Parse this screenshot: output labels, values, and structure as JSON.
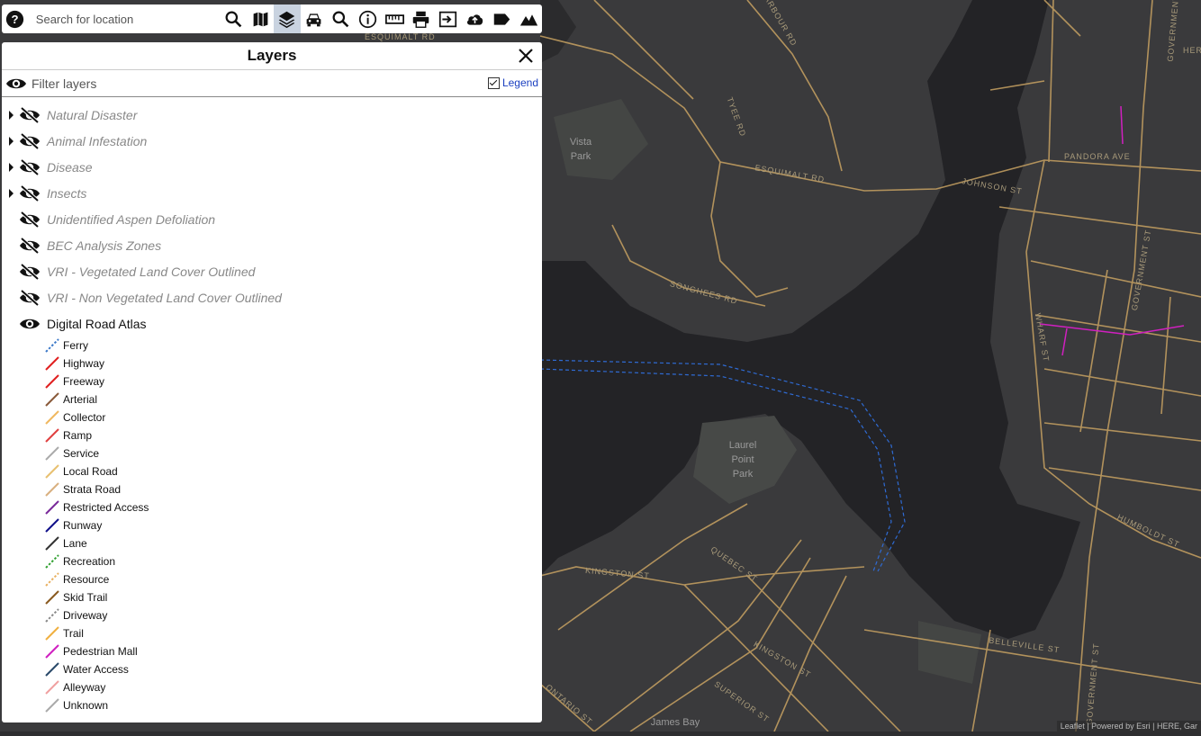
{
  "toolbar": {
    "search_placeholder": "Search for location",
    "buttons": [
      {
        "name": "help-icon"
      },
      {
        "name": "search-icon"
      },
      {
        "name": "map-icon"
      },
      {
        "name": "layers-icon",
        "active": true
      },
      {
        "name": "car-icon"
      },
      {
        "name": "identify-search-icon"
      },
      {
        "name": "info-icon"
      },
      {
        "name": "ruler-icon"
      },
      {
        "name": "print-icon"
      },
      {
        "name": "login-icon"
      },
      {
        "name": "upload-icon"
      },
      {
        "name": "label-icon"
      },
      {
        "name": "terrain-icon"
      }
    ]
  },
  "layers_panel": {
    "title": "Layers",
    "filter_placeholder": "Filter layers",
    "legend_label": "Legend",
    "legend_checked": true,
    "layers": [
      {
        "label": "Natural Disaster",
        "visible": false,
        "expandable": true
      },
      {
        "label": "Animal Infestation",
        "visible": false,
        "expandable": true
      },
      {
        "label": "Disease",
        "visible": false,
        "expandable": true
      },
      {
        "label": "Insects",
        "visible": false,
        "expandable": true
      },
      {
        "label": "Unidentified Aspen Defoliation",
        "visible": false,
        "expandable": false
      },
      {
        "label": "BEC Analysis Zones",
        "visible": false,
        "expandable": false
      },
      {
        "label": "VRI - Vegetated Land Cover Outlined",
        "visible": false,
        "expandable": false
      },
      {
        "label": "VRI - Non Vegetated Land Cover Outlined",
        "visible": false,
        "expandable": false
      },
      {
        "label": "Digital Road Atlas",
        "visible": true,
        "expandable": false
      }
    ],
    "legend": [
      {
        "label": "Ferry",
        "color": "#3a78c8",
        "dashed": true
      },
      {
        "label": "Highway",
        "color": "#e02020",
        "dashed": false
      },
      {
        "label": "Freeway",
        "color": "#e02020",
        "dashed": false
      },
      {
        "label": "Arterial",
        "color": "#8a5a3a",
        "dashed": false
      },
      {
        "label": "Collector",
        "color": "#f0b860",
        "dashed": false
      },
      {
        "label": "Ramp",
        "color": "#e04040",
        "dashed": false
      },
      {
        "label": "Service",
        "color": "#aaaaaa",
        "dashed": false
      },
      {
        "label": "Local Road",
        "color": "#e8c070",
        "dashed": false
      },
      {
        "label": "Strata Road",
        "color": "#d8b080",
        "dashed": false
      },
      {
        "label": "Restricted Access",
        "color": "#7a2a9a",
        "dashed": false
      },
      {
        "label": "Runway",
        "color": "#10108a",
        "dashed": false
      },
      {
        "label": "Lane",
        "color": "#333333",
        "dashed": false
      },
      {
        "label": "Recreation",
        "color": "#30a030",
        "dashed": true
      },
      {
        "label": "Resource",
        "color": "#e8b060",
        "dashed": true
      },
      {
        "label": "Skid Trail",
        "color": "#8a5a20",
        "dashed": false
      },
      {
        "label": "Driveway",
        "color": "#888888",
        "dashed": true
      },
      {
        "label": "Trail",
        "color": "#f0b040",
        "dashed": false
      },
      {
        "label": "Pedestrian Mall",
        "color": "#d020c0",
        "dashed": false
      },
      {
        "label": "Water Access",
        "color": "#2a4a6a",
        "dashed": false
      },
      {
        "label": "Alleyway",
        "color": "#f0a0a0",
        "dashed": false
      },
      {
        "label": "Unknown",
        "color": "#aaaaaa",
        "dashed": false
      }
    ]
  },
  "map": {
    "place_labels": [
      "Vista Park",
      "Laurel Point Park",
      "James Bay"
    ],
    "street_labels": [
      "ESQUIMALT RD",
      "HARBOUR RD",
      "TYEE RD",
      "ESQUIMALT RD",
      "JOHNSON ST",
      "PANDORA AVE",
      "SONGHEES RD",
      "GOVERNMENT ST",
      "WHARF ST",
      "HUMBOLDT ST",
      "KINGSTON ST",
      "QUEBEC ST",
      "KINGSTON ST",
      "BELLEVILLE ST",
      "SUPERIOR ST",
      "GOVERNMENT ST",
      "ONTARIO ST",
      "GOVERNMENT ST",
      "HERALD"
    ],
    "attribution": "Leaflet | Powered by Esri | HERE, Gar",
    "colors": {
      "water": "#232326",
      "land": "#3a3a3c",
      "park": "#454746",
      "road": "#c8a262",
      "ped_mall": "#d020c0",
      "ferry": "#2f6bd4"
    }
  }
}
